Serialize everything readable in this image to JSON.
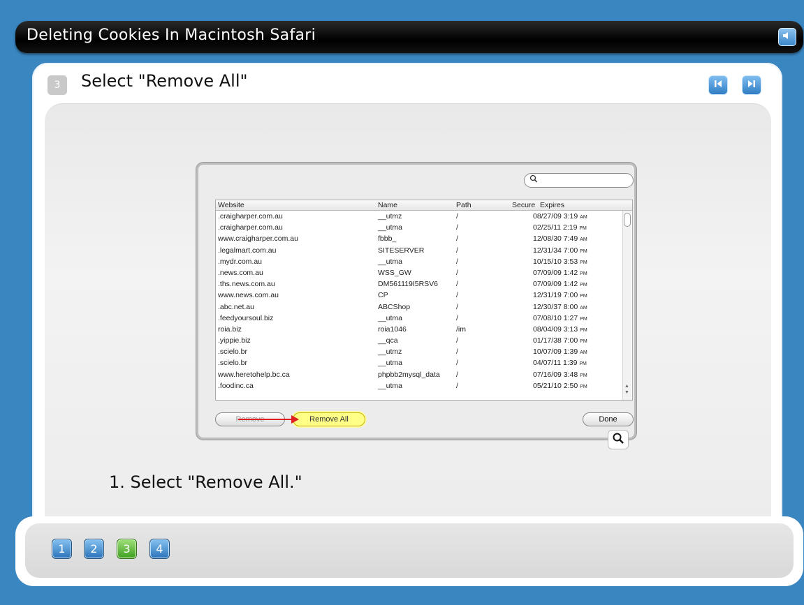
{
  "header": {
    "title": "Deleting Cookies In Macintosh Safari",
    "sound_icon": "speaker-icon"
  },
  "step": {
    "number": "3",
    "title": "Select \"Remove All\"",
    "prev_icon": "previous-icon",
    "next_icon": "next-icon"
  },
  "dialog": {
    "search_icon": "magnifier-icon",
    "columns": [
      "Website",
      "Name",
      "Path",
      "Secure",
      "Expires"
    ],
    "rows": [
      {
        "website": ".craigharper.com.au",
        "name": "__utmz",
        "path": "/",
        "date": "08/27/09",
        "time": "3:19",
        "ampm": "AM"
      },
      {
        "website": ".craigharper.com.au",
        "name": "__utma",
        "path": "/",
        "date": "02/25/11",
        "time": "2:19",
        "ampm": "PM"
      },
      {
        "website": "www.craigharper.com.au",
        "name": "fbbb_",
        "path": "/",
        "date": "12/08/30",
        "time": "7:49",
        "ampm": "AM"
      },
      {
        "website": ".legalmart.com.au",
        "name": "SITESERVER",
        "path": "/",
        "date": "12/31/34",
        "time": "7:00",
        "ampm": "PM"
      },
      {
        "website": ".mydr.com.au",
        "name": "__utma",
        "path": "/",
        "date": "10/15/10",
        "time": "3:53",
        "ampm": "PM"
      },
      {
        "website": ".news.com.au",
        "name": "WSS_GW",
        "path": "/",
        "date": "07/09/09",
        "time": "1:42",
        "ampm": "PM"
      },
      {
        "website": ".ths.news.com.au",
        "name": "DM561119I5RSV6",
        "path": "/",
        "date": "07/09/09",
        "time": "1:42",
        "ampm": "PM"
      },
      {
        "website": "www.news.com.au",
        "name": "CP",
        "path": "/",
        "date": "12/31/19",
        "time": "7:00",
        "ampm": "PM"
      },
      {
        "website": ".abc.net.au",
        "name": "ABCShop",
        "path": "/",
        "date": "12/30/37",
        "time": "8:00",
        "ampm": "AM"
      },
      {
        "website": ".feedyoursoul.biz",
        "name": "__utma",
        "path": "/",
        "date": "07/08/10",
        "time": "1:27",
        "ampm": "PM"
      },
      {
        "website": "roia.biz",
        "name": "roia1046",
        "path": "/im",
        "date": "08/04/09",
        "time": "3:13",
        "ampm": "PM"
      },
      {
        "website": ".yippie.biz",
        "name": "__qca",
        "path": "/",
        "date": "01/17/38",
        "time": "7:00",
        "ampm": "PM"
      },
      {
        "website": ".scielo.br",
        "name": "__utmz",
        "path": "/",
        "date": "10/07/09",
        "time": "1:39",
        "ampm": "AM"
      },
      {
        "website": ".scielo.br",
        "name": "__utma",
        "path": "/",
        "date": "04/07/11",
        "time": "1:39",
        "ampm": "PM"
      },
      {
        "website": "www.heretohelp.bc.ca",
        "name": "phpbb2mysql_data",
        "path": "/",
        "date": "07/16/09",
        "time": "3:48",
        "ampm": "PM"
      },
      {
        "website": ".foodinc.ca",
        "name": "__utma",
        "path": "/",
        "date": "05/21/10",
        "time": "2:50",
        "ampm": "PM"
      }
    ],
    "remove_label": "Remove",
    "remove_all_label": "Remove All",
    "done_label": "Done"
  },
  "zoom_icon": "zoom-icon",
  "instruction": "1. Select \"Remove All.\"",
  "pagination": [
    "1",
    "2",
    "3",
    "4"
  ],
  "current_page": "3",
  "colors": {
    "background": "#3a86c1",
    "page_active": "#3e9f1f",
    "page_inactive": "#2a73b8",
    "highlight": "#ffff88",
    "arrow": "#e02020"
  }
}
